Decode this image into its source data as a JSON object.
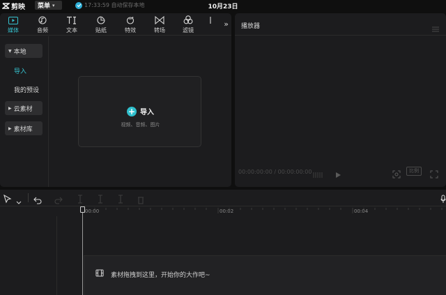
{
  "app": {
    "name": "剪映",
    "menu_label": "菜单",
    "save_status": "17:33:59 自动保存本地",
    "date": "10月23日"
  },
  "toolbar": {
    "tabs": [
      {
        "label": "媒体",
        "icon": "media-icon",
        "active": true
      },
      {
        "label": "音频",
        "icon": "audio-icon"
      },
      {
        "label": "文本",
        "icon": "text-icon"
      },
      {
        "label": "贴纸",
        "icon": "sticker-icon"
      },
      {
        "label": "特效",
        "icon": "effects-icon"
      },
      {
        "label": "转场",
        "icon": "transition-icon"
      },
      {
        "label": "滤镜",
        "icon": "filter-icon"
      }
    ],
    "more_icon": "double-chevron-right-icon"
  },
  "sidebar": {
    "local": "本地",
    "import": "导入",
    "my_presets": "我的预设",
    "cloud": "云素材",
    "library": "素材库"
  },
  "import_box": {
    "label": "导入",
    "hint": "视频、音频、图片"
  },
  "player": {
    "title": "播放器",
    "timecode_current": "00:00:00:00",
    "timecode_total": "00:00:00:00",
    "ratio_label": "比例"
  },
  "timeline": {
    "ruler_labels": [
      "00:00",
      "00:02",
      "00:04"
    ],
    "drop_hint": "素材拖拽到这里，开始你的大作吧~"
  },
  "colors": {
    "accent": "#36c2cf",
    "panel": "#1c1c1e",
    "background": "#0f0f0f"
  }
}
